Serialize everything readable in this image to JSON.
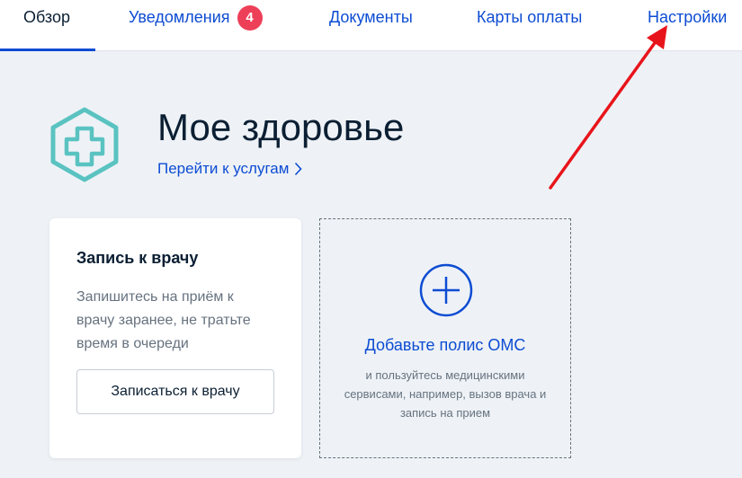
{
  "nav": {
    "tabs": [
      {
        "label": "Обзор",
        "active": true
      },
      {
        "label": "Уведомления",
        "count": "4"
      },
      {
        "label": "Документы"
      },
      {
        "label": "Карты оплаты"
      },
      {
        "label": "Настройки"
      }
    ]
  },
  "header": {
    "title": "Мое здоровье",
    "services_link": "Перейти к услугам",
    "logo_icon": "health-cross-icon"
  },
  "doctor_card": {
    "title": "Запись к врачу",
    "text": "Запишитесь на приём к врачу заранее, не тратьте время в очереди",
    "button_label": "Записаться к врачу"
  },
  "oms_card": {
    "icon": "plus-circle-icon",
    "title": "Добавьте полис ОМС",
    "subtitle": "и пользуйтесь медицинскими сервисами, например, вызов врача и запись на прием"
  },
  "colors": {
    "accent": "#0d4cd3",
    "badge": "#ee3f58",
    "logo": "#5ac3c1",
    "annotation_arrow": "#e8141b"
  }
}
